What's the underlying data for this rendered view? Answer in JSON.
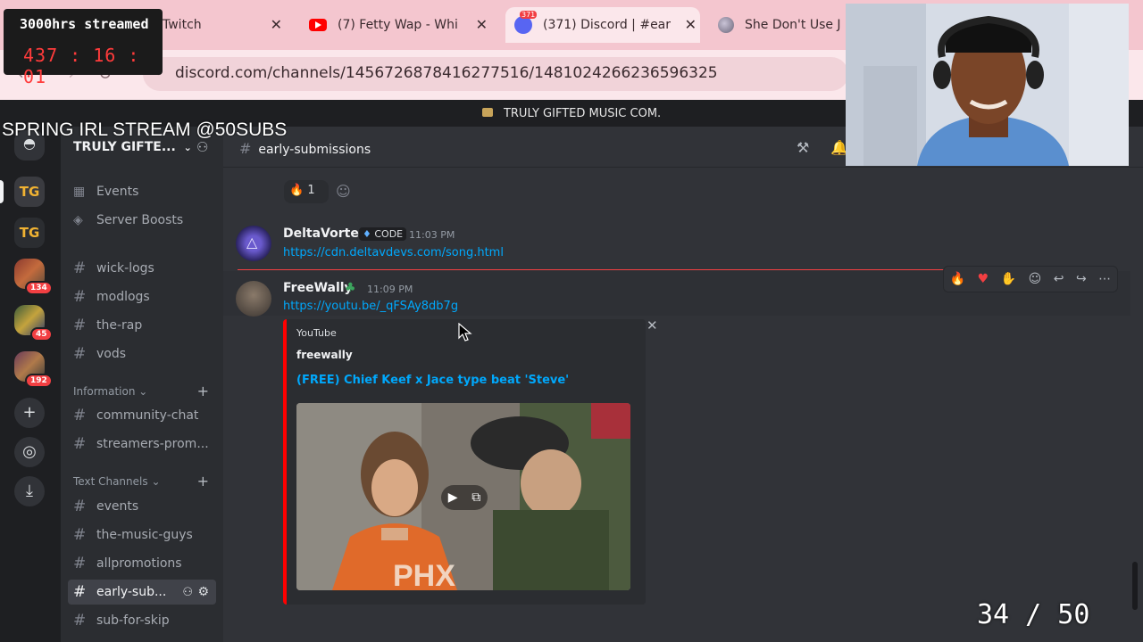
{
  "browser": {
    "tabs": [
      {
        "label": "Twitch",
        "active": false
      },
      {
        "label": "(7) Fetty Wap - Whi",
        "active": false
      },
      {
        "label": "(371) Discord | #ear",
        "active": true
      },
      {
        "label": "She Don't Use J",
        "active": false
      }
    ],
    "badge_count": "371",
    "url": "discord.com/channels/1456726878416277516/1481024266236596325"
  },
  "overlay": {
    "streamed_label": "3000hrs streamed",
    "timer_hours": "437",
    "timer_minutes": "16",
    "timer_seconds": "01",
    "title": "SPRING IRL STREAM @50SUBS",
    "counter": "34 / 50"
  },
  "banner": {
    "text": "TRULY GIFTED MUSIC COM."
  },
  "server": {
    "name": "TRULY GIFTE...",
    "rail_badges": [
      "134",
      "45",
      "192"
    ],
    "rail_tg_label": "TG"
  },
  "sidebar": {
    "top_items": [
      "Events",
      "Server Boosts"
    ],
    "channels_a": [
      "wick-logs",
      "modlogs",
      "the-rap",
      "vods"
    ],
    "category_info": "Information",
    "channels_b": [
      "community-chat",
      "streamers-prom..."
    ],
    "category_text": "Text Channels",
    "channels_c": [
      "events",
      "the-music-guys",
      "allpromotions",
      "early-sub...",
      "sub-for-skip"
    ]
  },
  "chat": {
    "channel": "early-submissions",
    "reaction_count": "1",
    "messages": [
      {
        "user": "DeltaVortex",
        "tag": "CODE",
        "time": "11:03 PM",
        "link": "https://cdn.deltavdevs.com/song.html"
      },
      {
        "user": "FreeWally",
        "time": "11:09 PM",
        "link": "https://youtu.be/_qFSAy8db7g"
      }
    ],
    "embed": {
      "provider": "YouTube",
      "author": "freewally",
      "title": "(FREE) Chief Keef x Jace type beat 'Steve'"
    }
  },
  "colors": {
    "discord_bg": "#313338",
    "sidebar_bg": "#2b2d31",
    "rail_bg": "#1e1f22",
    "link": "#00a8fc",
    "embed_accent": "#ff0000",
    "tab_bar": "#f4c6cf"
  }
}
